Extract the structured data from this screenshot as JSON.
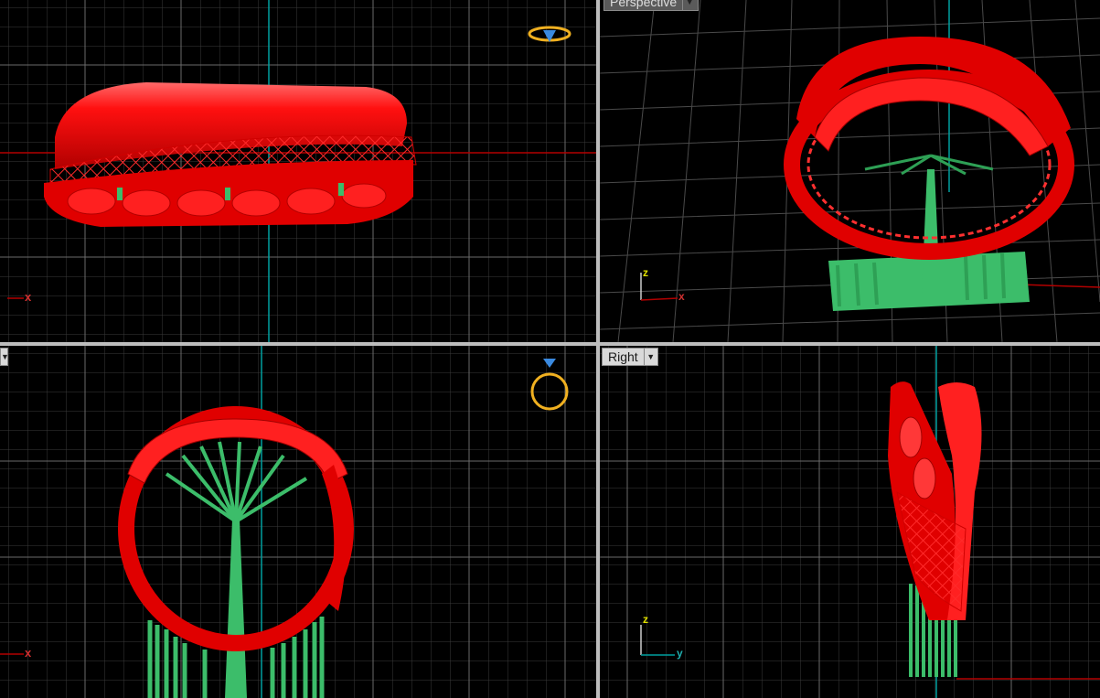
{
  "viewports": {
    "top_left": {
      "name": "",
      "axis_label": "x"
    },
    "top_right": {
      "name": "Perspective",
      "axis_x": "x",
      "axis_z": "z"
    },
    "bottom_left": {
      "name": "",
      "axis_label": "x"
    },
    "bottom_right": {
      "name": "Right",
      "axis_z": "z",
      "axis_y": "y"
    }
  },
  "colors": {
    "background": "#000000",
    "grid_minor": "#3a3a3a",
    "grid_major": "#6a6a6a",
    "axis_x": "#b30000",
    "axis_y": "#00a0a0",
    "model_red": "#e00000",
    "support_green": "#3cbd6a",
    "gumball_orange": "#f0b020",
    "gumball_blue": "#3a8ae0"
  },
  "icons": [
    "ring-preview-icon-top",
    "ring-preview-icon-front",
    "viewport-menu-chevron-icon"
  ]
}
